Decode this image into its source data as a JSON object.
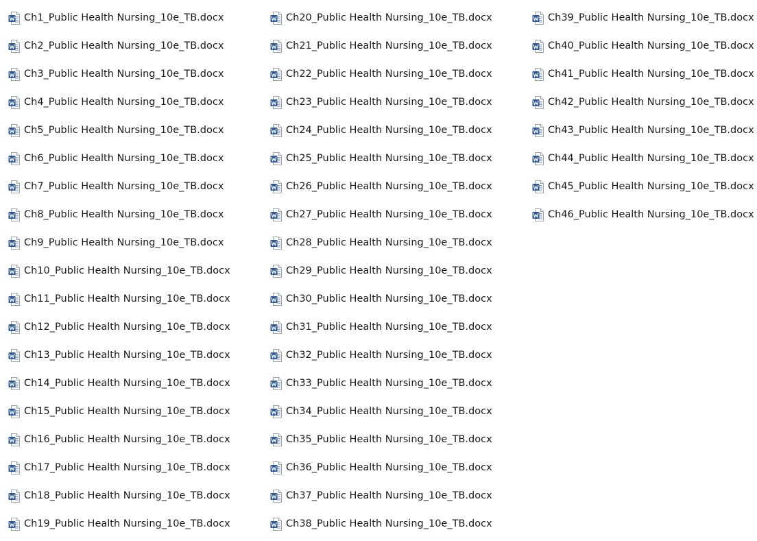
{
  "icon": "word-document-icon",
  "icon_colors": {
    "brand": "#2b579a",
    "page": "#ffffff",
    "page_border": "#9aa3ad",
    "lines": "#8fa6c8"
  },
  "files": [
    "Ch1_Public Health Nursing_10e_TB.docx",
    "Ch2_Public Health Nursing_10e_TB.docx",
    "Ch3_Public Health Nursing_10e_TB.docx",
    "Ch4_Public Health Nursing_10e_TB.docx",
    "Ch5_Public Health Nursing_10e_TB.docx",
    "Ch6_Public Health Nursing_10e_TB.docx",
    "Ch7_Public Health Nursing_10e_TB.docx",
    "Ch8_Public Health Nursing_10e_TB.docx",
    "Ch9_Public Health Nursing_10e_TB.docx",
    "Ch10_Public Health Nursing_10e_TB.docx",
    "Ch11_Public Health Nursing_10e_TB.docx",
    "Ch12_Public Health Nursing_10e_TB.docx",
    "Ch13_Public Health Nursing_10e_TB.docx",
    "Ch14_Public Health Nursing_10e_TB.docx",
    "Ch15_Public Health Nursing_10e_TB.docx",
    "Ch16_Public Health Nursing_10e_TB.docx",
    "Ch17_Public Health Nursing_10e_TB.docx",
    "Ch18_Public Health Nursing_10e_TB.docx",
    "Ch19_Public Health Nursing_10e_TB.docx",
    "Ch20_Public Health Nursing_10e_TB.docx",
    "Ch21_Public Health Nursing_10e_TB.docx",
    "Ch22_Public Health Nursing_10e_TB.docx",
    "Ch23_Public Health Nursing_10e_TB.docx",
    "Ch24_Public Health Nursing_10e_TB.docx",
    "Ch25_Public Health Nursing_10e_TB.docx",
    "Ch26_Public Health Nursing_10e_TB.docx",
    "Ch27_Public Health Nursing_10e_TB.docx",
    "Ch28_Public Health Nursing_10e_TB.docx",
    "Ch29_Public Health Nursing_10e_TB.docx",
    "Ch30_Public Health Nursing_10e_TB.docx",
    "Ch31_Public Health Nursing_10e_TB.docx",
    "Ch32_Public Health Nursing_10e_TB.docx",
    "Ch33_Public Health Nursing_10e_TB.docx",
    "Ch34_Public Health Nursing_10e_TB.docx",
    "Ch35_Public Health Nursing_10e_TB.docx",
    "Ch36_Public Health Nursing_10e_TB.docx",
    "Ch37_Public Health Nursing_10e_TB.docx",
    "Ch38_Public Health Nursing_10e_TB.docx",
    "Ch39_Public Health Nursing_10e_TB.docx",
    "Ch40_Public Health Nursing_10e_TB.docx",
    "Ch41_Public Health Nursing_10e_TB.docx",
    "Ch42_Public Health Nursing_10e_TB.docx",
    "Ch43_Public Health Nursing_10e_TB.docx",
    "Ch44_Public Health Nursing_10e_TB.docx",
    "Ch45_Public Health Nursing_10e_TB.docx",
    "Ch46_Public Health Nursing_10e_TB.docx"
  ]
}
